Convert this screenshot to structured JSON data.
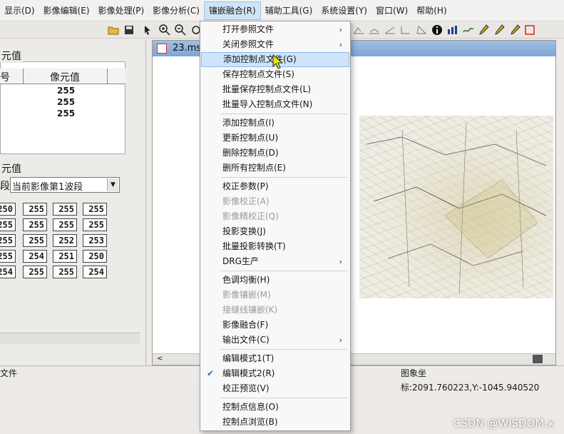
{
  "menubar": {
    "items": [
      "显示(D)",
      "影像编辑(E)",
      "影像处理(P)",
      "影像分析(C)",
      "镶嵌融合(R)",
      "辅助工具(G)",
      "系统设置(Y)",
      "窗口(W)",
      "帮助(H)"
    ]
  },
  "toolbar": {
    "icons": [
      "open-folder-icon",
      "save-icon",
      "pointer-icon",
      "zoom-in-icon",
      "zoom-out-icon"
    ],
    "right_icons": [
      "info-icon",
      "bar-chart-icon",
      "line-chart-icon",
      "pen-icon",
      "pen2-icon",
      "pen3-icon",
      "rect-icon"
    ]
  },
  "left_panel": {
    "group1_title": "元值",
    "group1_col1": "号",
    "group1_col2": "像元值",
    "group1_values": [
      "255",
      "255",
      "255"
    ],
    "group2_title": "元值",
    "band_label": "段",
    "band_select": "当前影像第1波段",
    "grid": [
      [
        "250",
        "255",
        "255",
        "255"
      ],
      [
        "255",
        "255",
        "255",
        "255"
      ],
      [
        "255",
        "255",
        "252",
        "253"
      ],
      [
        "255",
        "254",
        "251",
        "250"
      ],
      [
        "254",
        "255",
        "255",
        "254"
      ]
    ]
  },
  "image_window": {
    "title": "23.msi"
  },
  "status": {
    "left": "文件",
    "coords": "图象坐标:2091.760223,Y:-1045.940520"
  },
  "dropdown": {
    "items": [
      {
        "label": "打开参照文件",
        "submenu": true
      },
      {
        "label": "关闭参照文件",
        "submenu": true
      },
      {
        "label": "添加控制点文件(G)",
        "highlighted": true
      },
      {
        "label": "保存控制点文件(S)"
      },
      {
        "label": "批量保存控制点文件(L)"
      },
      {
        "label": "批量导入控制点文件(N)"
      },
      {
        "label": "添加控制点(I)"
      },
      {
        "label": "更新控制点(U)"
      },
      {
        "label": "删除控制点(D)"
      },
      {
        "label": "删所有控制点(E)"
      },
      {
        "label": "校正参数(P)"
      },
      {
        "label": "影像校正(A)",
        "disabled": true
      },
      {
        "label": "影像精校正(Q)",
        "disabled": true
      },
      {
        "label": "投影变换(J)"
      },
      {
        "label": "批量投影转换(T)"
      },
      {
        "label": "DRG生产",
        "submenu": true
      },
      {
        "label": "色调均衡(H)"
      },
      {
        "label": "影像镶嵌(M)",
        "disabled": true
      },
      {
        "label": "接缝线镶嵌(K)",
        "disabled": true
      },
      {
        "label": "影像融合(F)"
      },
      {
        "label": "输出文件(C)",
        "submenu": true
      },
      {
        "label": "编辑模式1(T)"
      },
      {
        "label": "编辑模式2(R)",
        "checked": true
      },
      {
        "label": "校正预览(V)"
      },
      {
        "label": "控制点信息(O)"
      },
      {
        "label": "控制点浏览(B)"
      }
    ]
  },
  "watermark": "CSDN @WISDOM.x"
}
